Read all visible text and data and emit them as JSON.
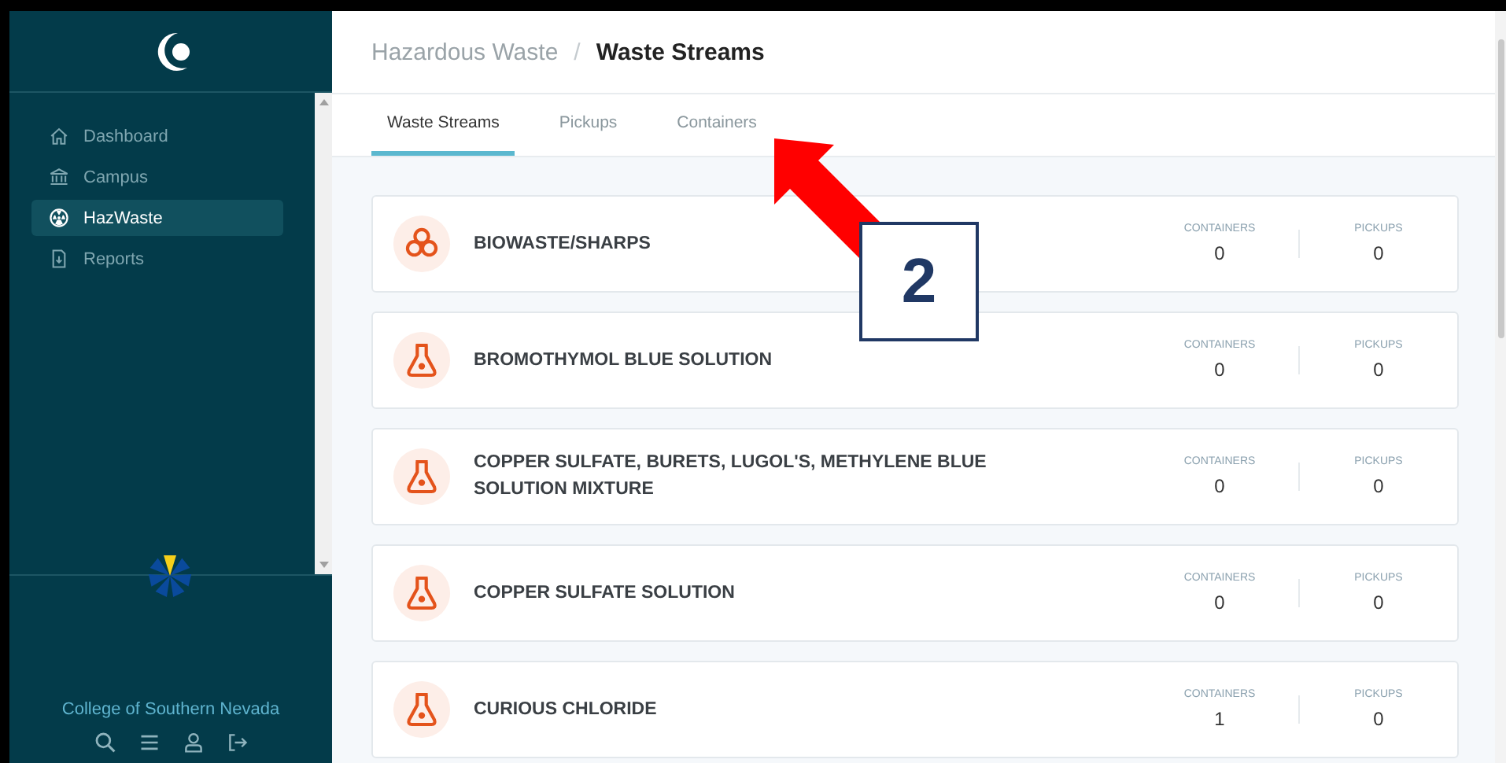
{
  "sidebar": {
    "items": [
      {
        "label": "Dashboard",
        "kind": "home",
        "selected": false
      },
      {
        "label": "Campus",
        "kind": "campus",
        "selected": false
      },
      {
        "label": "HazWaste",
        "kind": "hazard",
        "selected": true
      },
      {
        "label": "Reports",
        "kind": "report",
        "selected": false
      }
    ],
    "institution": "College of Southern Nevada"
  },
  "breadcrumb": {
    "parent": "Hazardous Waste",
    "separator": "/",
    "current": "Waste Streams"
  },
  "tabs": [
    {
      "label": "Waste Streams",
      "selected": true
    },
    {
      "label": "Pickups",
      "selected": false
    },
    {
      "label": "Containers",
      "selected": false
    }
  ],
  "streams": [
    {
      "name": "BIOWASTE/SHARPS",
      "kind": "biohazard",
      "containers_label": "CONTAINERS",
      "containers": "0",
      "pickups_label": "PICKUPS",
      "pickups": "0"
    },
    {
      "name": "BROMOTHYMOL BLUE SOLUTION",
      "kind": "flask",
      "containers_label": "CONTAINERS",
      "containers": "0",
      "pickups_label": "PICKUPS",
      "pickups": "0"
    },
    {
      "name": "COPPER SULFATE, BURETS, LUGOL'S, METHYLENE BLUE SOLUTION MIXTURE",
      "kind": "flask",
      "containers_label": "CONTAINERS",
      "containers": "0",
      "pickups_label": "PICKUPS",
      "pickups": "0"
    },
    {
      "name": "COPPER SULFATE SOLUTION",
      "kind": "flask",
      "containers_label": "CONTAINERS",
      "containers": "0",
      "pickups_label": "PICKUPS",
      "pickups": "0"
    },
    {
      "name": "CURIOUS CHLORIDE",
      "kind": "flask",
      "containers_label": "CONTAINERS",
      "containers": "1",
      "pickups_label": "PICKUPS",
      "pickups": "0"
    }
  ],
  "annotation": {
    "number": "2"
  }
}
